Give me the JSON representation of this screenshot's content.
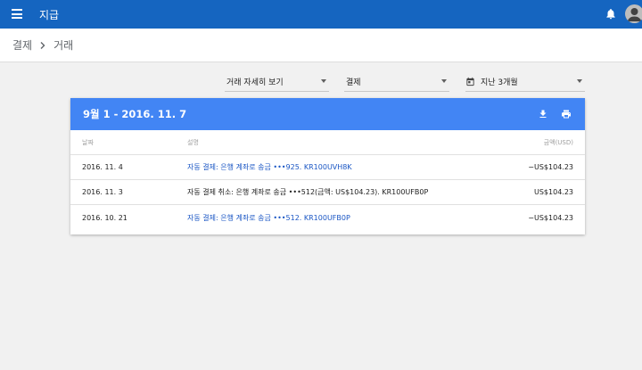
{
  "app": {
    "title": "지급"
  },
  "breadcrumb": {
    "parent": "결제",
    "current": "거래"
  },
  "filters": {
    "view": "거래 자세히 보기",
    "type": "결제",
    "period": "지난 3개월"
  },
  "card": {
    "range": "9월 1 - 2016. 11. 7",
    "columns": {
      "date": "날짜",
      "description": "설명",
      "amount": "금액(USD)"
    },
    "rows": [
      {
        "date": "2016. 11. 4",
        "description": "자동 결제: 은행 계좌로 송금 •••925. KR100UVH8K",
        "amount": "−US$104.23",
        "link": true
      },
      {
        "date": "2016. 11. 3",
        "description": "자동 결제 취소: 은행 계좌로 송금 •••512(금액: US$104.23). KR100UFB0P",
        "amount": "US$104.23",
        "link": false
      },
      {
        "date": "2016. 10. 21",
        "description": "자동 결제: 은행 계좌로 송금 •••512. KR100UFB0P",
        "amount": "−US$104.23",
        "link": true
      }
    ]
  },
  "colors": {
    "appbar": "#1565c0",
    "card_header": "#4285f4",
    "link": "#1a56c4"
  },
  "icons": [
    "menu-icon",
    "bell-icon",
    "avatar",
    "chevron-right-icon",
    "calendar-icon",
    "download-icon",
    "print-icon"
  ]
}
